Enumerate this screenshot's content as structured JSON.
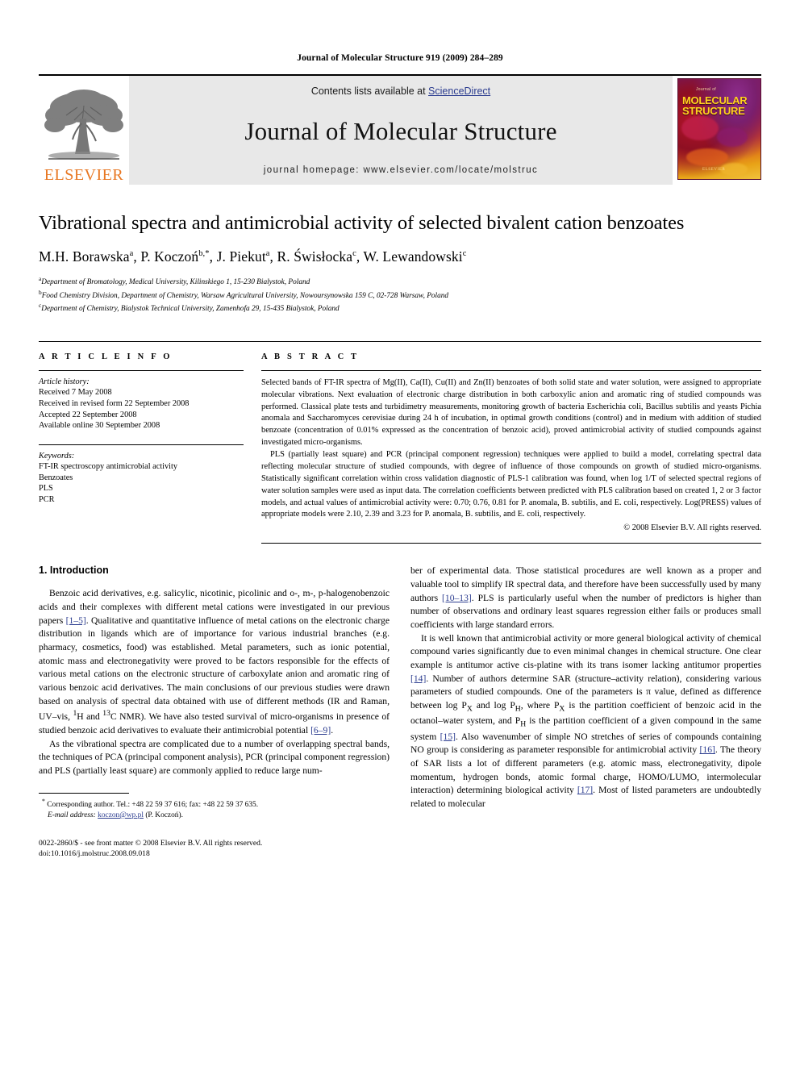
{
  "running_head": "Journal of Molecular Structure 919 (2009) 284–289",
  "masthead": {
    "contents_prefix": "Contents lists available at ",
    "sciencedirect": "ScienceDirect",
    "journal_title": "Journal of Molecular Structure",
    "homepage": "journal homepage: www.elsevier.com/locate/molstruc",
    "elsevier_wordmark": "ELSEVIER",
    "elsevier_color": "#E87722",
    "link_color": "#2b3c8f",
    "band_color": "#e8e8e8",
    "cover": {
      "top_word": "Journal of",
      "line1": "MOLECULAR",
      "line2": "STRUCTURE",
      "publisher": "ELSEVIER",
      "title_color": "#FFD21E"
    }
  },
  "article": {
    "title": "Vibrational spectra and antimicrobial activity of selected bivalent cation benzoates",
    "authors": [
      {
        "name": "M.H. Borawska",
        "marks": "a"
      },
      {
        "name": "P. Koczoń",
        "marks": "b,*"
      },
      {
        "name": "J. Piekut",
        "marks": "a"
      },
      {
        "name": "R. Świsłocka",
        "marks": "c"
      },
      {
        "name": "W. Lewandowski",
        "marks": "c"
      }
    ],
    "affiliations": [
      {
        "mark": "a",
        "text": "Department of Bromatology, Medical University, Kilinskiego 1, 15-230 Bialystok, Poland"
      },
      {
        "mark": "b",
        "text": "Food Chemistry Division, Department of Chemistry, Warsaw Agricultural University, Nowoursynowska 159 C, 02-728 Warsaw, Poland"
      },
      {
        "mark": "c",
        "text": "Department of Chemistry, Bialystok Technical University, Zamenhofa 29, 15-435 Bialystok, Poland"
      }
    ]
  },
  "article_info": {
    "heading": "A R T I C L E    I N F O",
    "history_label": "Article history:",
    "history": [
      "Received 7 May 2008",
      "Received in revised form 22 September 2008",
      "Accepted 22 September 2008",
      "Available online 30 September 2008"
    ],
    "keywords_label": "Keywords:",
    "keywords": [
      "FT-IR spectroscopy antimicrobial activity",
      "Benzoates",
      "PLS",
      "PCR"
    ]
  },
  "abstract": {
    "heading": "A B S T R A C T",
    "paragraph1": "Selected bands of FT-IR spectra of Mg(II), Ca(II), Cu(II) and Zn(II) benzoates of both solid state and water solution, were assigned to appropriate molecular vibrations. Next evaluation of electronic charge distribution in both carboxylic anion and aromatic ring of studied compounds was performed. Classical plate tests and turbidimetry measurements, monitoring growth of bacteria Escherichia coli, Bacillus subtilis and yeasts Pichia anomala and Saccharomyces cerevisiae during 24 h of incubation, in optimal growth conditions (control) and in medium with addition of studied benzoate (concentration of 0.01% expressed as the concentration of benzoic acid), proved antimicrobial activity of studied compounds against investigated micro-organisms.",
    "paragraph2": "PLS (partially least square) and PCR (principal component regression) techniques were applied to build a model, correlating spectral data reflecting molecular structure of studied compounds, with degree of influence of those compounds on growth of studied micro-organisms. Statistically significant correlation within cross validation diagnostic of PLS-1 calibration was found, when log 1/T of selected spectral regions of water solution samples were used as input data. The correlation coefficients between predicted with PLS calibration based on created 1, 2 or 3 factor models, and actual values of antimicrobial activity were: 0.70; 0.76, 0.81 for P. anomala, B. subtilis, and E. coli, respectively. Log(PRESS) values of appropriate models were 2.10, 2.39 and 3.23 for P. anomala, B. subtilis, and E. coli, respectively.",
    "copyright": "© 2008 Elsevier B.V. All rights reserved."
  },
  "introduction": {
    "heading": "1. Introduction",
    "left_p1_a": "Benzoic acid derivatives, e.g. salicylic, nicotinic, picolinic and o-, m-, p-halogenobenzoic acids and their complexes with different metal cations were investigated in our previous papers ",
    "left_p1_cite1": "[1–5]",
    "left_p1_b": ". Qualitative and quantitative influence of metal cations on the electronic charge distribution in ligands which are of importance for various industrial branches (e.g. pharmacy, cosmetics, food) was established. Metal parameters, such as ionic potential, atomic mass and electronegativity were proved to be factors responsible for the effects of various metal cations on the electronic structure of carboxylate anion and aromatic ring of various benzoic acid derivatives. The main conclusions of our previous studies were drawn based on analysis of spectral data obtained with use of different methods (IR and Raman, UV–vis, ",
    "left_p1_sup1": "1",
    "left_p1_c": "H and ",
    "left_p1_sup2": "13",
    "left_p1_d": "C NMR). We have also tested survival of micro-organisms in presence of studied benzoic acid derivatives to evaluate their antimicrobial potential ",
    "left_p1_cite2": "[6–9]",
    "left_p1_e": ".",
    "left_p2": "As the vibrational spectra are complicated due to a number of overlapping spectral bands, the techniques of PCA (principal component analysis), PCR (principal component regression) and PLS (partially least square) are commonly applied to reduce large num-",
    "right_p1_a": "ber of experimental data. Those statistical procedures are well known as a proper and valuable tool to simplify IR spectral data, and therefore have been successfully used by many authors ",
    "right_p1_cite": "[10–13]",
    "right_p1_b": ". PLS is particularly useful when the number of predictors is higher than number of observations and ordinary least squares regression either fails or produces small coefficients with large standard errors.",
    "right_p2_a": "It is well known that antimicrobial activity or more general biological activity of chemical compound varies significantly due to even minimal changes in chemical structure. One clear example is antitumor active cis-platine with its trans isomer lacking antitumor properties ",
    "right_p2_cite1": "[14]",
    "right_p2_b": ". Number of authors determine SAR (structure–activity relation), considering various parameters of studied compounds. One of the parameters is π value, defined as difference between log P",
    "right_p2_subX": "X",
    "right_p2_c": " and log P",
    "right_p2_subH": "H",
    "right_p2_d": ", where P",
    "right_p2_subX2": "X",
    "right_p2_e": " is the partition coefficient of benzoic acid in the octanol–water system, and P",
    "right_p2_subH2": "H",
    "right_p2_f": " is the partition coefficient of a given compound in the same system ",
    "right_p2_cite2": "[15]",
    "right_p2_g": ". Also wavenumber of simple NO stretches of series of compounds containing NO group is considering as parameter responsible for antimicrobial activity ",
    "right_p2_cite3": "[16]",
    "right_p2_h": ". The theory of SAR lists a lot of different parameters (e.g. atomic mass, electronegativity, dipole momentum, hydrogen bonds, atomic formal charge, HOMO/LUMO, intermolecular interaction) determining biological activity ",
    "right_p2_cite4": "[17]",
    "right_p2_i": ". Most of listed parameters are undoubtedly related to molecular"
  },
  "footer": {
    "corresponding_mark": "*",
    "corresponding": " Corresponding author. Tel.: +48 22 59 37 616; fax: +48 22 59 37 635.",
    "email_label": "E-mail address:",
    "email": "koczon@wp.pl",
    "email_suffix": " (P. Koczoń).",
    "imprint_line1": "0022-2860/$ - see front matter © 2008 Elsevier B.V. All rights reserved.",
    "imprint_line2": "doi:10.1016/j.molstruc.2008.09.018"
  }
}
